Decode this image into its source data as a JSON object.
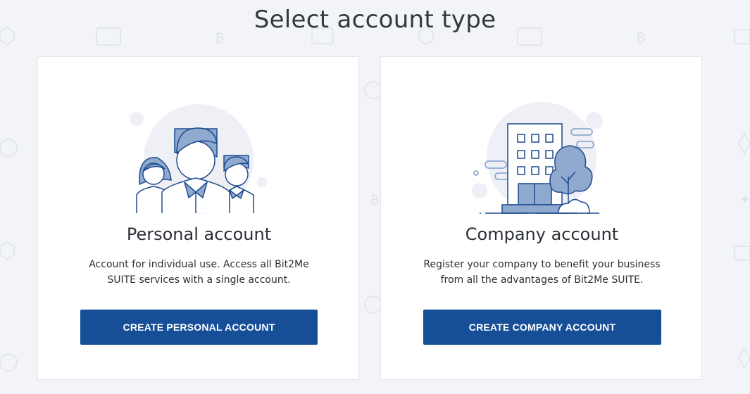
{
  "page": {
    "title": "Select account type"
  },
  "cards": [
    {
      "id": "personal",
      "title": "Personal account",
      "description": "Account for individual use. Access all Bit2Me SUITE services with a single account.",
      "button_label": "CREATE PERSONAL ACCOUNT",
      "illustration_icon": "people-group-icon"
    },
    {
      "id": "company",
      "title": "Company account",
      "description": "Register your company to benefit your business from all the advantages of Bit2Me SUITE.",
      "button_label": "CREATE COMPANY ACCOUNT",
      "illustration_icon": "office-building-icon"
    }
  ],
  "colors": {
    "primary_button": "#164e97",
    "illustration_fill": "#8fa9cf",
    "illustration_stroke": "#1d4b8f",
    "background": "#f3f4f8"
  }
}
